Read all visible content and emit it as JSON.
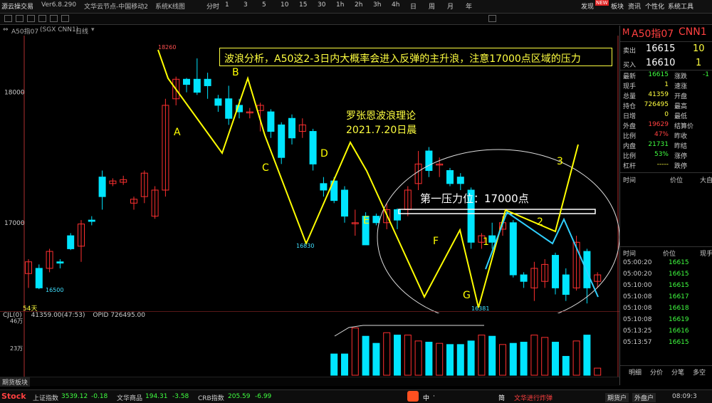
{
  "app": {
    "name": "源云操交易",
    "version": "Ver6.8.290",
    "server": "文华云节点-中国移动2",
    "menu_title": "系统K线图",
    "periods": [
      "分时",
      "1",
      "3",
      "5",
      "10",
      "15",
      "30",
      "1h",
      "2h",
      "3h",
      "4h",
      "日",
      "周",
      "月",
      "年"
    ],
    "right_menu": [
      "发现",
      "板块",
      "资讯",
      "个性化",
      "系统工具"
    ],
    "new_badge": "NEW"
  },
  "chart_header": {
    "symbol": "A50指07",
    "detail": "(SGX CNN1)",
    "mode": "日线",
    "mode_marker": "▾"
  },
  "annotations": {
    "headline": "波浪分析，A50这2-3日内大概率会进入反弹的主升浪，注意17000点区域的压力",
    "theory": "罗张恩波浪理论",
    "date": "2021.7.20日晨",
    "resistance": "第一压力位：17000点",
    "wave_labels": [
      "A",
      "B",
      "C",
      "D",
      "E",
      "F",
      "G",
      "1",
      "2",
      "3"
    ],
    "price_labels": [
      "18260",
      "16500",
      "16830",
      "16381"
    ],
    "days_label": "54天"
  },
  "chart_data": [
    {
      "type": "candlestick",
      "ytick_labels": [
        "18000",
        "17000"
      ],
      "ylim": [
        16360,
        18380
      ],
      "candles": [
        [
          16610,
          16700,
          16500,
          16720
        ],
        [
          16650,
          16500,
          16490,
          16680
        ],
        [
          16650,
          16780,
          16620,
          16800
        ],
        [
          16700,
          16690,
          16650,
          16720
        ],
        [
          16900,
          16800,
          16790,
          16920
        ],
        [
          16820,
          16990,
          16700,
          17020
        ],
        [
          17020,
          17010,
          16980,
          17050
        ],
        [
          17350,
          17200,
          17100,
          17400
        ],
        [
          17300,
          17320,
          17280,
          17340
        ],
        [
          17310,
          17330,
          17290,
          17360
        ],
        [
          17150,
          17180,
          17100,
          17200
        ],
        [
          17200,
          17380,
          17150,
          17400
        ],
        [
          17050,
          17250,
          17030,
          17280
        ],
        [
          17250,
          17900,
          17200,
          17950
        ],
        [
          17950,
          18100,
          17900,
          18120
        ],
        [
          18100,
          18060,
          18000,
          18110
        ],
        [
          18100,
          18000,
          17980,
          18260
        ],
        [
          18100,
          18050,
          17950,
          18150
        ],
        [
          17950,
          17900,
          17850,
          17980
        ],
        [
          17950,
          17800,
          17750,
          18050
        ],
        [
          17900,
          17850,
          17800,
          17950
        ],
        [
          17850,
          17850,
          17800,
          17880
        ],
        [
          17860,
          17900,
          17700,
          17920
        ],
        [
          17850,
          17700,
          17650,
          17870
        ],
        [
          17750,
          17500,
          17450,
          17770
        ],
        [
          17800,
          17650,
          17600,
          17830
        ],
        [
          17700,
          17750,
          17650,
          17800
        ],
        [
          17700,
          17450,
          17400,
          17720
        ],
        [
          17300,
          17250,
          17200,
          17350
        ],
        [
          17320,
          17170,
          17150,
          17350
        ],
        [
          17250,
          17050,
          17000,
          17280
        ],
        [
          17000,
          17000,
          16900,
          17100
        ],
        [
          17050,
          16830,
          16830,
          17080
        ],
        [
          17050,
          17000,
          16980,
          17070
        ],
        [
          17000,
          17100,
          16950,
          17150
        ],
        [
          17100,
          17020,
          16950,
          17110
        ],
        [
          17100,
          17250,
          17050,
          17280
        ],
        [
          17300,
          17450,
          17250,
          17550
        ],
        [
          17550,
          17400,
          17350,
          17580
        ],
        [
          17450,
          17450,
          17350,
          17500
        ],
        [
          17400,
          17300,
          17280,
          17420
        ],
        [
          17350,
          17300,
          17250,
          17380
        ],
        [
          17250,
          16850,
          16800,
          17270
        ],
        [
          16850,
          16900,
          16800,
          16920
        ],
        [
          16900,
          16850,
          16800,
          17000
        ],
        [
          16950,
          17000,
          16900,
          17050
        ],
        [
          17000,
          16600,
          16580,
          17020
        ],
        [
          16600,
          16550,
          16500,
          16620
        ],
        [
          16500,
          16650,
          16400,
          16700
        ],
        [
          16550,
          16680,
          16500,
          16720
        ],
        [
          16750,
          16500,
          16450,
          16770
        ],
        [
          16600,
          16450,
          16400,
          16650
        ],
        [
          16500,
          16850,
          16480,
          16900
        ],
        [
          16780,
          16500,
          16381,
          16800
        ],
        [
          16550,
          16600,
          16500,
          16620
        ]
      ]
    },
    {
      "type": "bar",
      "title": "CJL(0)",
      "readout": "41359.00(47:53)",
      "opid": "OPID 726495.00",
      "ytick_labels": [
        "46万",
        "23万"
      ],
      "ylim": [
        0,
        470000
      ],
      "values": [
        180000,
        180000,
        400000,
        330000,
        270000,
        360000,
        340000,
        340000,
        290000,
        280000,
        270000,
        260000,
        260000,
        290000,
        340000,
        330000,
        260000,
        270000,
        280000,
        340000,
        320000,
        280000,
        160000,
        290000,
        340000,
        60000
      ]
    }
  ],
  "right_panel": {
    "symbol": "A50指07",
    "code": "CNN1",
    "marker": "M",
    "ask_label": "卖出",
    "ask_price": "16615",
    "ask_vol": "10",
    "bid_label": "买入",
    "bid_price": "16610",
    "bid_vol": "1",
    "stats": [
      {
        "l": "最新",
        "v": "16615",
        "l2": "涨跌",
        "v2": "-1"
      },
      {
        "l": "现手",
        "v": "1",
        "l2": "速涨",
        "v2": ""
      },
      {
        "l": "总量",
        "v": "41359",
        "l2": "开盘",
        "v2": ""
      },
      {
        "l": "持仓",
        "v": "726495",
        "l2": "最高",
        "v2": ""
      },
      {
        "l": "日增",
        "v": "0",
        "l2": "最低",
        "v2": ""
      },
      {
        "l": "外盘",
        "v": "19629",
        "l2": "结算价",
        "v2": ""
      },
      {
        "l": "比例",
        "v": "47%",
        "l2": "昨收",
        "v2": ""
      },
      {
        "l": "内盘",
        "v": "21731",
        "l2": "昨结",
        "v2": ""
      },
      {
        "l": "比例",
        "v": "53%",
        "l2": "涨停",
        "v2": ""
      },
      {
        "l": "杠杆",
        "v": "-----",
        "l2": "跌停",
        "v2": ""
      }
    ],
    "trade_headers": [
      "时间",
      "价位",
      "大自"
    ],
    "trade_headers2": [
      "时间",
      "价位",
      "现手"
    ],
    "trades": [
      {
        "t": "05:00:20",
        "p": "16615"
      },
      {
        "t": "05:00:20",
        "p": "16615"
      },
      {
        "t": "05:10:00",
        "p": "16615"
      },
      {
        "t": "05:10:08",
        "p": "16617"
      },
      {
        "t": "05:10:08",
        "p": "16618"
      },
      {
        "t": "05:10:08",
        "p": "16619"
      },
      {
        "t": "05:13:25",
        "p": "16616"
      },
      {
        "t": "05:13:57",
        "p": "16615"
      }
    ],
    "tabs": [
      "明细",
      "分价",
      "分笔",
      "多空"
    ]
  },
  "bottom_tab": "期货板块",
  "status": {
    "logo": "Stock",
    "index1_name": "上证指数",
    "index1_val": "3539.12",
    "index1_chg": "-0.18",
    "index2_name": "文华商品",
    "index2_val": "194.31",
    "index2_chg": "-3.58",
    "index3_name": "CRB指数",
    "index3_val": "205.59",
    "index3_chg": "-6.99",
    "ime": [
      "中",
      "·",
      "简"
    ],
    "notice": "文华进行炸弹",
    "btn1": "期货户",
    "btn2": "外盘户",
    "clock": "08:09:3"
  },
  "colors": {
    "up": "#ff3030",
    "down": "#00e5ff",
    "wave_yellow": "#ffff00",
    "wave_cyan": "#30d0ff"
  }
}
